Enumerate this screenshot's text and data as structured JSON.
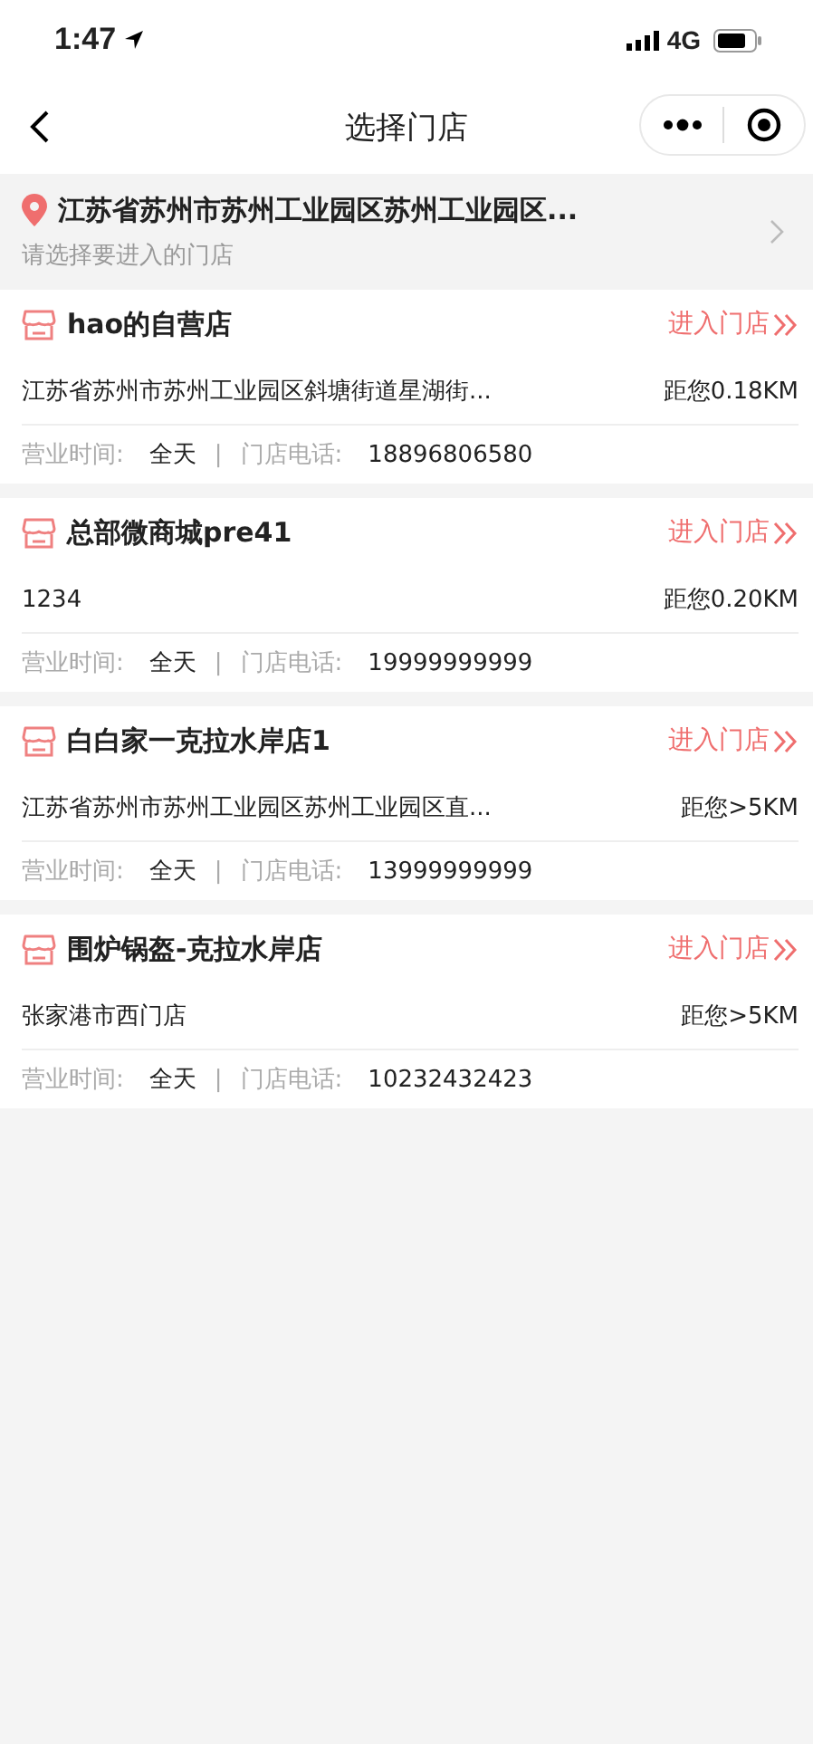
{
  "status_bar": {
    "time": "1:47",
    "network": "4G"
  },
  "nav": {
    "title": "选择门店"
  },
  "location": {
    "address": "江苏省苏州市苏州工业园区苏州工业园区...",
    "hint": "请选择要进入的门店"
  },
  "stores": [
    {
      "name": "hao的自营店",
      "enter": "进入门店",
      "address": "江苏省苏州市苏州工业园区斜塘街道星湖街...",
      "distance": "距您0.18KM",
      "hours_label": "营业时间:",
      "hours": "全天",
      "separator": "|",
      "phone_label": "门店电话:",
      "phone": "18896806580"
    },
    {
      "name": "总部微商城pre41",
      "enter": "进入门店",
      "address": "1234",
      "distance": "距您0.20KM",
      "hours_label": "营业时间:",
      "hours": "全天",
      "separator": "|",
      "phone_label": "门店电话:",
      "phone": "19999999999"
    },
    {
      "name": "白白家一克拉水岸店1",
      "enter": "进入门店",
      "address": "江苏省苏州市苏州工业园区苏州工业园区直...",
      "distance": "距您>5KM",
      "hours_label": "营业时间:",
      "hours": "全天",
      "separator": "|",
      "phone_label": "门店电话:",
      "phone": "13999999999"
    },
    {
      "name": "围炉锅盔-克拉水岸店",
      "enter": "进入门店",
      "address": "张家港市西门店",
      "distance": "距您>5KM",
      "hours_label": "营业时间:",
      "hours": "全天",
      "separator": "|",
      "phone_label": "门店电话:",
      "phone": "10232432423"
    }
  ]
}
